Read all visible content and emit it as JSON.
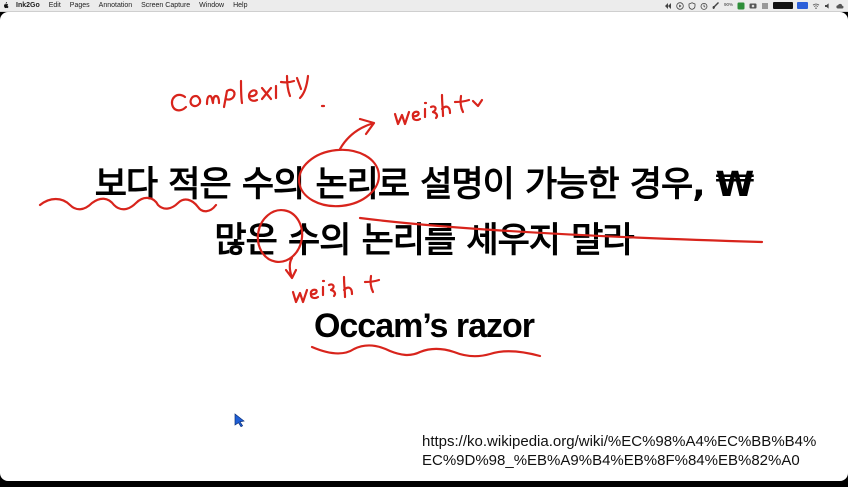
{
  "menubar": {
    "items": [
      "Ink2Go",
      "Edit",
      "Pages",
      "Annotation",
      "Screen Capture",
      "Window",
      "Help"
    ],
    "battery_percent": "90%"
  },
  "slide": {
    "line1": "보다 적은 수의 논리로 설명이 가능한 경우, ₩",
    "line2": "많은 수의 논리를 세우지 말라",
    "title": "Occam’s razor",
    "url_line1": "https://ko.wikipedia.org/wiki/%EC%98%A4%EC%BB%B4%",
    "url_line2": "EC%9D%98_%EB%A9%B4%EB%8F%84%EB%82%A0"
  },
  "annotations": {
    "handwriting": [
      "Complexity",
      "weight",
      "weight"
    ],
    "ink_color": "#d8241c"
  }
}
